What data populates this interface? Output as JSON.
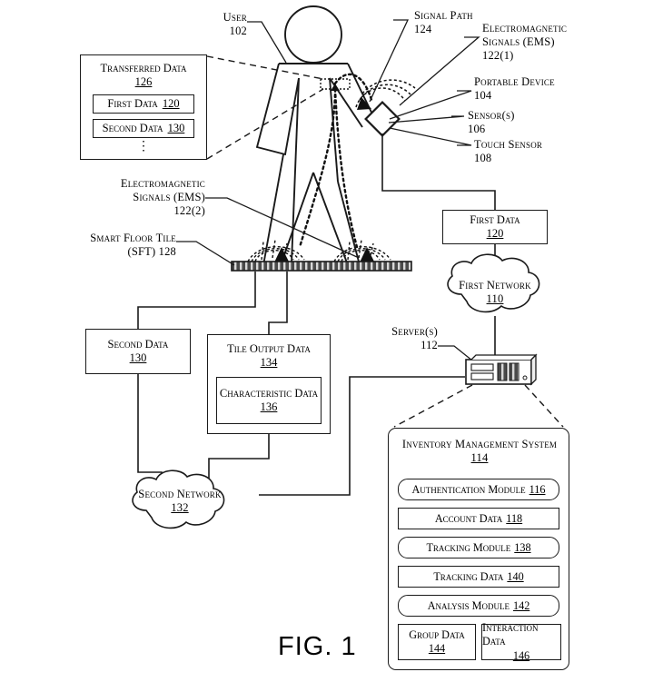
{
  "figure": {
    "caption": "FIG. 1"
  },
  "labels": {
    "user": {
      "text": "User",
      "num": "102"
    },
    "signal_path": {
      "text": "Signal Path",
      "num": "124"
    },
    "ems1": {
      "line1": "Electromagnetic",
      "line2": "Signals (EMS)",
      "num": "122(1)"
    },
    "portable_device": {
      "text": "Portable Device",
      "num": "104"
    },
    "sensors": {
      "text": "Sensor(s)",
      "num": "106"
    },
    "touch_sensor": {
      "text": "Touch Sensor",
      "num": "108"
    },
    "ems2": {
      "line1": "Electromagnetic",
      "line2": "Signals (EMS)",
      "num": "122(2)"
    },
    "smart_floor_tile": {
      "line1": "Smart Floor Tile",
      "line2": "(SFT) 128"
    },
    "servers": {
      "text": "Server(s)",
      "num": "112"
    }
  },
  "boxes": {
    "transferred_data": {
      "title": "Transferred Data",
      "num": "126",
      "children": [
        {
          "title": "First Data",
          "num": "120"
        },
        {
          "title": "Second Data",
          "num": "130"
        }
      ],
      "ellipsis": "⋮"
    },
    "first_data": {
      "title": "First Data",
      "num": "120"
    },
    "second_data": {
      "title": "Second Data",
      "num": "130"
    },
    "tile_output_data": {
      "title": "Tile Output Data",
      "num": "134",
      "child": {
        "title": "Characteristic Data",
        "num": "136"
      }
    }
  },
  "clouds": {
    "first_network": {
      "title": "First Network",
      "num": "110"
    },
    "second_network": {
      "title": "Second Network",
      "num": "132"
    }
  },
  "inventory_management_system": {
    "title": "Inventory Management System",
    "num": "114",
    "rows": [
      {
        "title": "Authentication Module",
        "num": "116",
        "shape": "round"
      },
      {
        "title": "Account Data",
        "num": "118",
        "shape": "rect"
      },
      {
        "title": "Tracking Module",
        "num": "138",
        "shape": "round"
      },
      {
        "title": "Tracking Data",
        "num": "140",
        "shape": "rect"
      },
      {
        "title": "Analysis Module",
        "num": "142",
        "shape": "round"
      }
    ],
    "bottom": [
      {
        "title": "Group Data",
        "num": "144"
      },
      {
        "title": "Interaction Data",
        "num": "146"
      }
    ]
  },
  "colors": {
    "ink": "#1a1a1a",
    "paper": "#ffffff",
    "tile": "#3a3a3a"
  }
}
